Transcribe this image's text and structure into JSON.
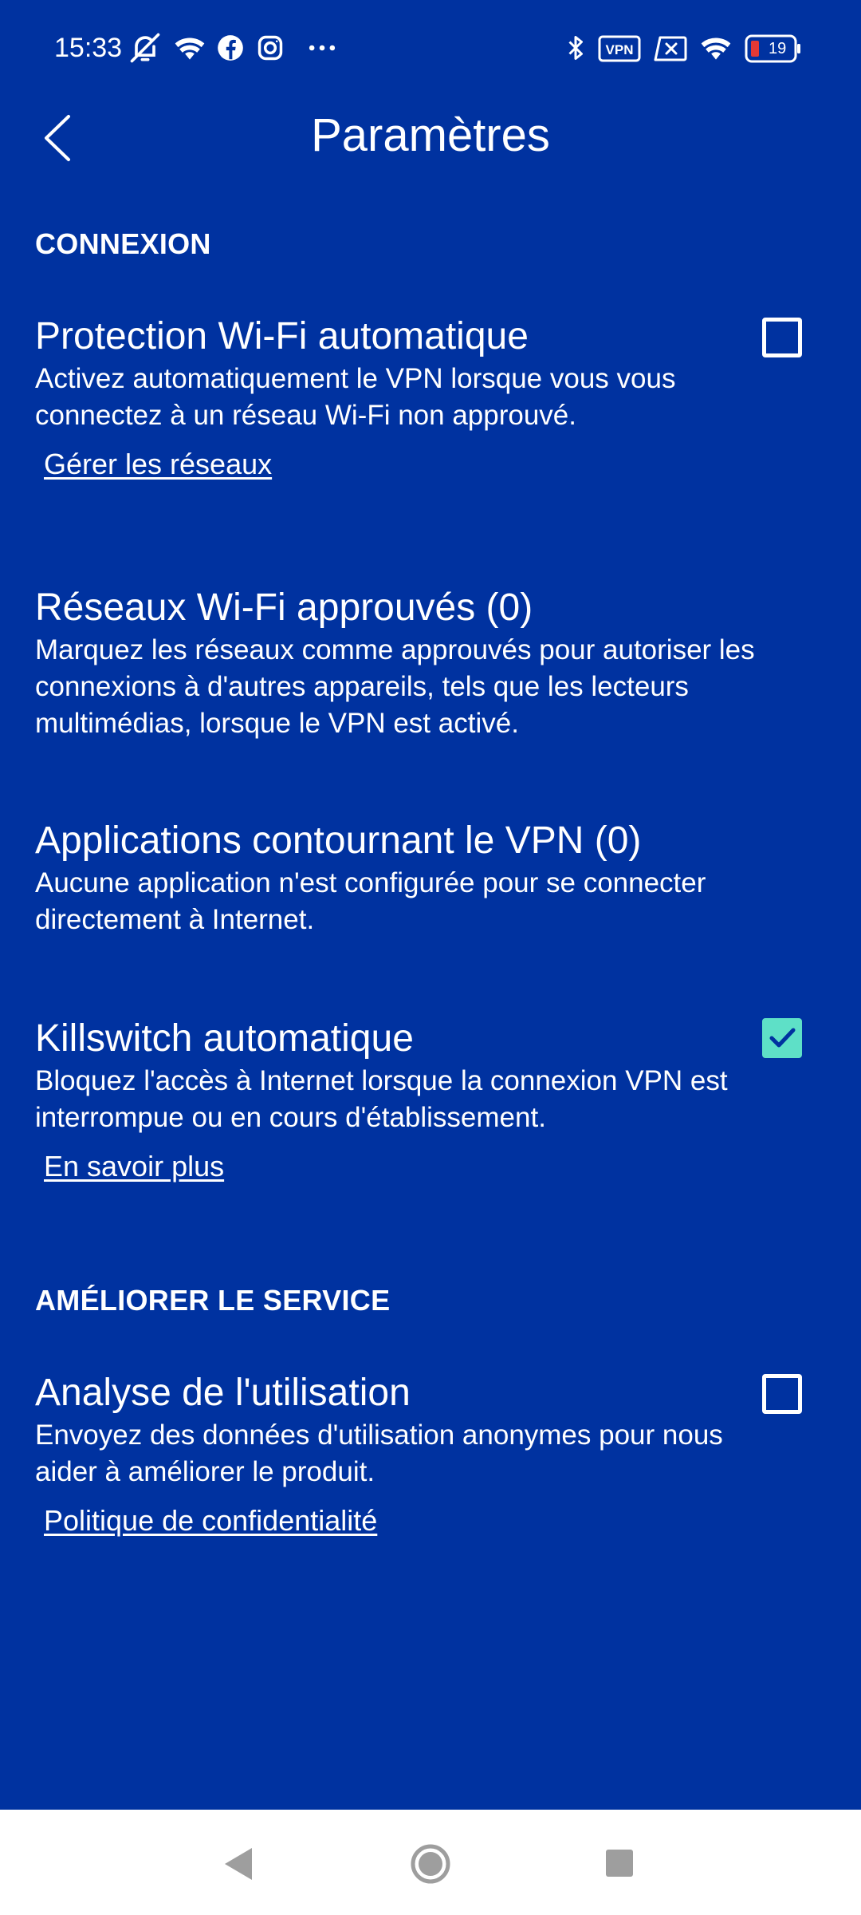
{
  "status_bar": {
    "time": "15:33",
    "icons": [
      "muted-bell-icon",
      "wifi-icon",
      "facebook-icon",
      "instagram-icon",
      "more-dots-icon",
      "bluetooth-icon",
      "vpn-icon",
      "no-signal-icon",
      "wifi-icon",
      "battery-icon"
    ],
    "vpn_label": "VPN",
    "battery_level": "19"
  },
  "header": {
    "title": "Paramètres",
    "back_icon": "chevron-left-icon"
  },
  "sections": [
    {
      "title": "CONNEXION",
      "items": [
        {
          "title": "Protection Wi-Fi automatique",
          "description": "Activez automatiquement le VPN lorsque vous vous connectez à un réseau Wi-Fi non approuvé.",
          "link": "Gérer les réseaux",
          "checked": false
        },
        {
          "title": "Réseaux Wi-Fi approuvés (0)",
          "description": "Marquez les réseaux comme approuvés pour autoriser les connexions à d'autres appareils, tels que les lecteurs multimédias, lorsque le VPN est activé."
        },
        {
          "title": "Applications contournant le VPN (0)",
          "description": "Aucune application n'est configurée pour se connecter directement à Internet."
        },
        {
          "title": "Killswitch automatique",
          "description": "Bloquez l'accès à Internet lorsque la connexion VPN est interrompue ou en cours d'établissement.",
          "link": "En savoir plus",
          "checked": true
        }
      ]
    },
    {
      "title": "AMÉLIORER LE SERVICE",
      "items": [
        {
          "title": "Analyse de l'utilisation",
          "description": "Envoyez des données d'utilisation anonymes pour nous aider à améliorer le produit.",
          "link": "Politique de confidentialité",
          "checked": false
        }
      ]
    }
  ],
  "colors": {
    "background": "#0032a0",
    "text": "#ffffff",
    "checkbox_checked": "#5ee0c7",
    "nav_bar": "#ffffff",
    "nav_icons": "#9e9e9e"
  },
  "nav_bar": {
    "icons": [
      "back-triangle-icon",
      "home-circle-icon",
      "recents-square-icon"
    ]
  }
}
